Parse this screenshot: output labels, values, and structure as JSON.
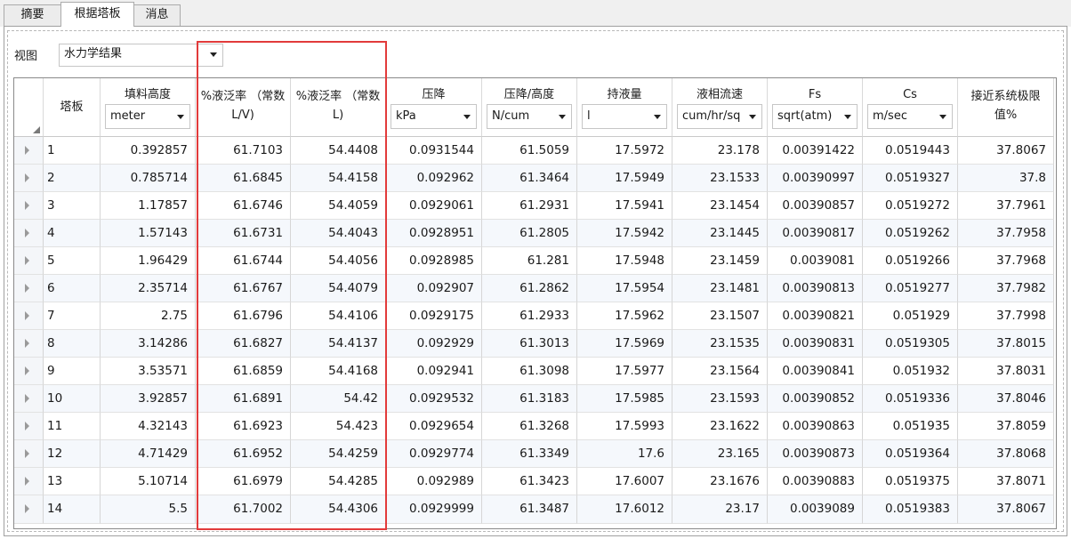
{
  "tabs": [
    {
      "label": "摘要"
    },
    {
      "label": "根据塔板"
    },
    {
      "label": "消息"
    }
  ],
  "active_tab": "根据塔板",
  "view": {
    "label": "视图",
    "value": "水力学结果"
  },
  "columns": [
    {
      "label": "塔板",
      "unit": ""
    },
    {
      "label": "填料高度",
      "unit": "meter"
    },
    {
      "label": "%液泛率 （常数L/V)",
      "unit": ""
    },
    {
      "label": "%液泛率 （常数L)",
      "unit": ""
    },
    {
      "label": "压降",
      "unit": "kPa"
    },
    {
      "label": "压降/高度",
      "unit": "N/cum"
    },
    {
      "label": "持液量",
      "unit": "l"
    },
    {
      "label": "液相流速",
      "unit": "cum/hr/sq"
    },
    {
      "label": "Fs",
      "unit": "sqrt(atm)"
    },
    {
      "label": "Cs",
      "unit": "m/sec"
    },
    {
      "label": "接近系统极限值%",
      "unit": ""
    }
  ],
  "rows": [
    [
      "1",
      "0.392857",
      "61.7103",
      "54.4408",
      "0.0931544",
      "61.5059",
      "17.5972",
      "23.178",
      "0.00391422",
      "0.0519443",
      "37.8067"
    ],
    [
      "2",
      "0.785714",
      "61.6845",
      "54.4158",
      "0.092962",
      "61.3464",
      "17.5949",
      "23.1533",
      "0.00390997",
      "0.0519327",
      "37.8"
    ],
    [
      "3",
      "1.17857",
      "61.6746",
      "54.4059",
      "0.0929061",
      "61.2931",
      "17.5941",
      "23.1454",
      "0.00390857",
      "0.0519272",
      "37.7961"
    ],
    [
      "4",
      "1.57143",
      "61.6731",
      "54.4043",
      "0.0928951",
      "61.2805",
      "17.5942",
      "23.1445",
      "0.00390817",
      "0.0519262",
      "37.7958"
    ],
    [
      "5",
      "1.96429",
      "61.6744",
      "54.4056",
      "0.0928985",
      "61.281",
      "17.5948",
      "23.1459",
      "0.0039081",
      "0.0519266",
      "37.7968"
    ],
    [
      "6",
      "2.35714",
      "61.6767",
      "54.4079",
      "0.092907",
      "61.2862",
      "17.5954",
      "23.1481",
      "0.00390813",
      "0.0519277",
      "37.7982"
    ],
    [
      "7",
      "2.75",
      "61.6796",
      "54.4106",
      "0.0929175",
      "61.2933",
      "17.5962",
      "23.1507",
      "0.00390821",
      "0.051929",
      "37.7998"
    ],
    [
      "8",
      "3.14286",
      "61.6827",
      "54.4137",
      "0.092929",
      "61.3013",
      "17.5969",
      "23.1535",
      "0.00390831",
      "0.0519305",
      "37.8015"
    ],
    [
      "9",
      "3.53571",
      "61.6859",
      "54.4168",
      "0.092941",
      "61.3098",
      "17.5977",
      "23.1564",
      "0.00390841",
      "0.051932",
      "37.8031"
    ],
    [
      "10",
      "3.92857",
      "61.6891",
      "54.42",
      "0.0929532",
      "61.3183",
      "17.5985",
      "23.1593",
      "0.00390852",
      "0.0519336",
      "37.8046"
    ],
    [
      "11",
      "4.32143",
      "61.6923",
      "54.423",
      "0.0929654",
      "61.3268",
      "17.5993",
      "23.1622",
      "0.00390863",
      "0.051935",
      "37.8059"
    ],
    [
      "12",
      "4.71429",
      "61.6952",
      "54.4259",
      "0.0929774",
      "61.3349",
      "17.6",
      "23.165",
      "0.00390873",
      "0.0519364",
      "37.8068"
    ],
    [
      "13",
      "5.10714",
      "61.6979",
      "54.4285",
      "0.092989",
      "61.3423",
      "17.6007",
      "23.1676",
      "0.00390883",
      "0.0519375",
      "37.8071"
    ],
    [
      "14",
      "5.5",
      "61.7002",
      "54.4306",
      "0.0929999",
      "61.3487",
      "17.6012",
      "23.17",
      "0.0039089",
      "0.0519383",
      "37.8067"
    ]
  ],
  "colors": {
    "highlight": "#e23b3b",
    "row_alt": "#f5f8fc"
  }
}
